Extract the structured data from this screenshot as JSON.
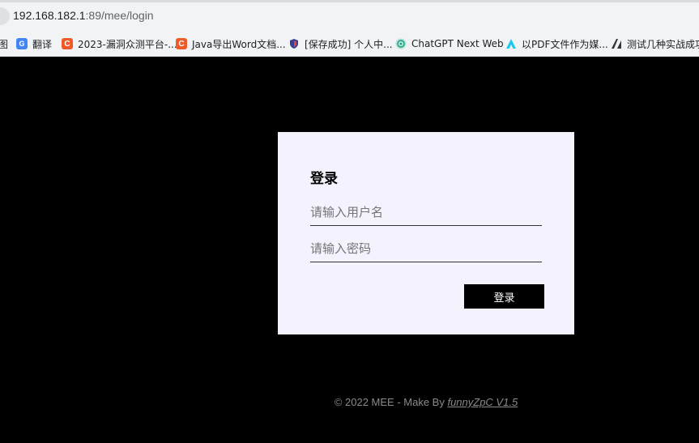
{
  "browser": {
    "url_host": "192.168.182.1",
    "url_path": ":89/mee/login"
  },
  "bookmarks": [
    {
      "label": "图",
      "icon": "partial-bookmark"
    },
    {
      "label": "翻译",
      "icon": "translate-icon"
    },
    {
      "label": "2023-漏洞众测平台-...",
      "icon": "c-logo-icon"
    },
    {
      "label": "Java导出Word文档...",
      "icon": "c-logo-icon"
    },
    {
      "label": "[保存成功] 个人中...",
      "icon": "shield-icon"
    },
    {
      "label": "ChatGPT Next Web",
      "icon": "chatgpt-icon"
    },
    {
      "label": "以PDF文件作为媒...",
      "icon": "triangle-logo-icon"
    },
    {
      "label": "测试几种实战成功",
      "icon": "dark-logo-icon"
    }
  ],
  "login": {
    "title": "登录",
    "username_placeholder": "请输入用户名",
    "password_placeholder": "请输入密码",
    "submit_label": "登录"
  },
  "footer": {
    "prefix": "© 2022 MEE - Make By ",
    "author_link": "funnyZpC V1.5"
  }
}
